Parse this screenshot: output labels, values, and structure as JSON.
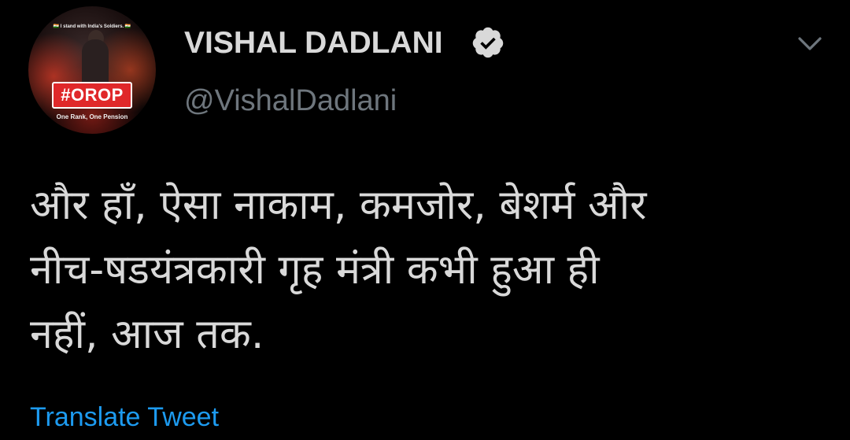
{
  "author": {
    "display_name": "VISHAL DADLANI",
    "handle": "@VishalDadlani",
    "verified": true,
    "avatar": {
      "top_caption": "🇮🇳 I stand with India's Soldiers. 🇮🇳",
      "badge_text": "#OROP",
      "sub_caption": "One Rank, One Pension",
      "badge_color": "#e0282a"
    }
  },
  "tweet": {
    "text": "और हाँ, ऐसा नाकाम, कमजोर, बेशर्म और\nनीच-षडयंत्रकारी गृह मंत्री कभी हुआ ही\nनहीं, आज तक.",
    "translate_label": "Translate Tweet"
  },
  "icons": {
    "verified": "verified-badge-icon",
    "menu": "chevron-down-icon"
  },
  "colors": {
    "background": "#000000",
    "text": "#d9d9d9",
    "secondary_text": "#6e767d",
    "link": "#1d9bf0"
  }
}
